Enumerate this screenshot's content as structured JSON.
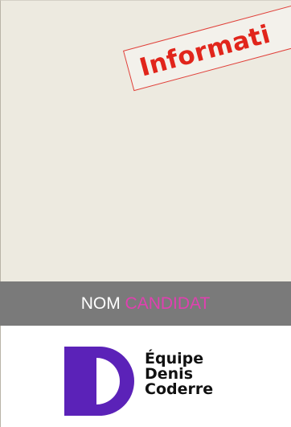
{
  "stamp": {
    "text": "Informati"
  },
  "candidate": {
    "label_nom": "NOM",
    "label_candidat": "CANDIDAT"
  },
  "logo": {
    "line1": "Équipe",
    "line2": "Denis",
    "line3": "Coderre"
  },
  "colors": {
    "photo_bg": "#edeae0",
    "bar_bg": "#7a7a7a",
    "candidat_accent": "#e040b0",
    "stamp_red": "#e1251b",
    "logo_purple": "#5b22b8"
  }
}
